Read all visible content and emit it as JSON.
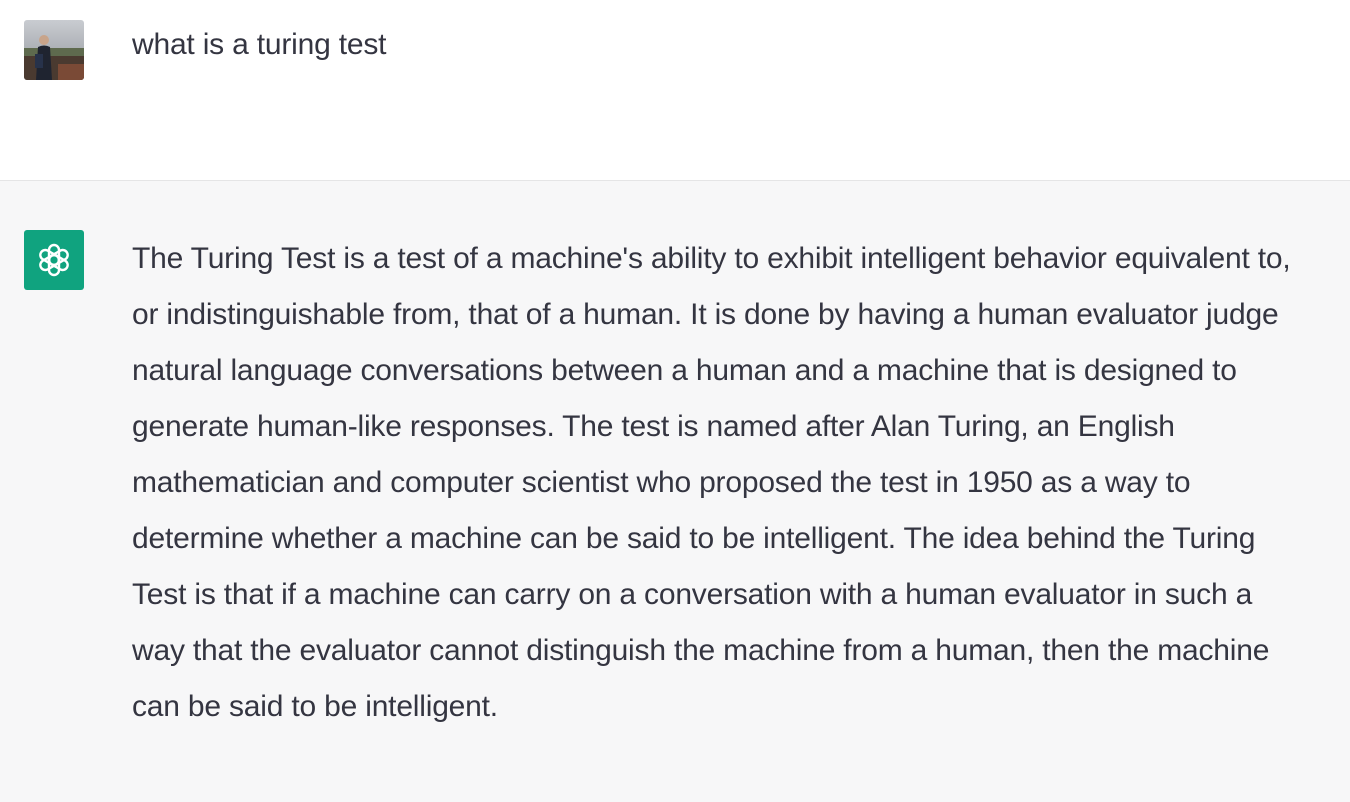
{
  "conversation": {
    "user_message": {
      "text": "what is a turing test",
      "avatar_icon": "user-photo-avatar"
    },
    "assistant_message": {
      "text": "The Turing Test is a test of a machine's ability to exhibit intelligent behavior equivalent to, or indistinguishable from, that of a human. It is done by having a human evaluator judge natural language conversations between a human and a machine that is designed to generate human-like responses. The test is named after Alan Turing, an English mathematician and computer scientist who proposed the test in 1950 as a way to determine whether a machine can be said to be intelligent. The idea behind the Turing Test is that if a machine can carry on a conversation with a human evaluator in such a way that the evaluator cannot distinguish the machine from a human, then the machine can be said to be intelligent.",
      "avatar_icon": "openai-logo-icon",
      "avatar_color": "#10a37f"
    }
  },
  "colors": {
    "user_background": "#ffffff",
    "assistant_background": "#f7f7f8",
    "text": "#343541"
  }
}
